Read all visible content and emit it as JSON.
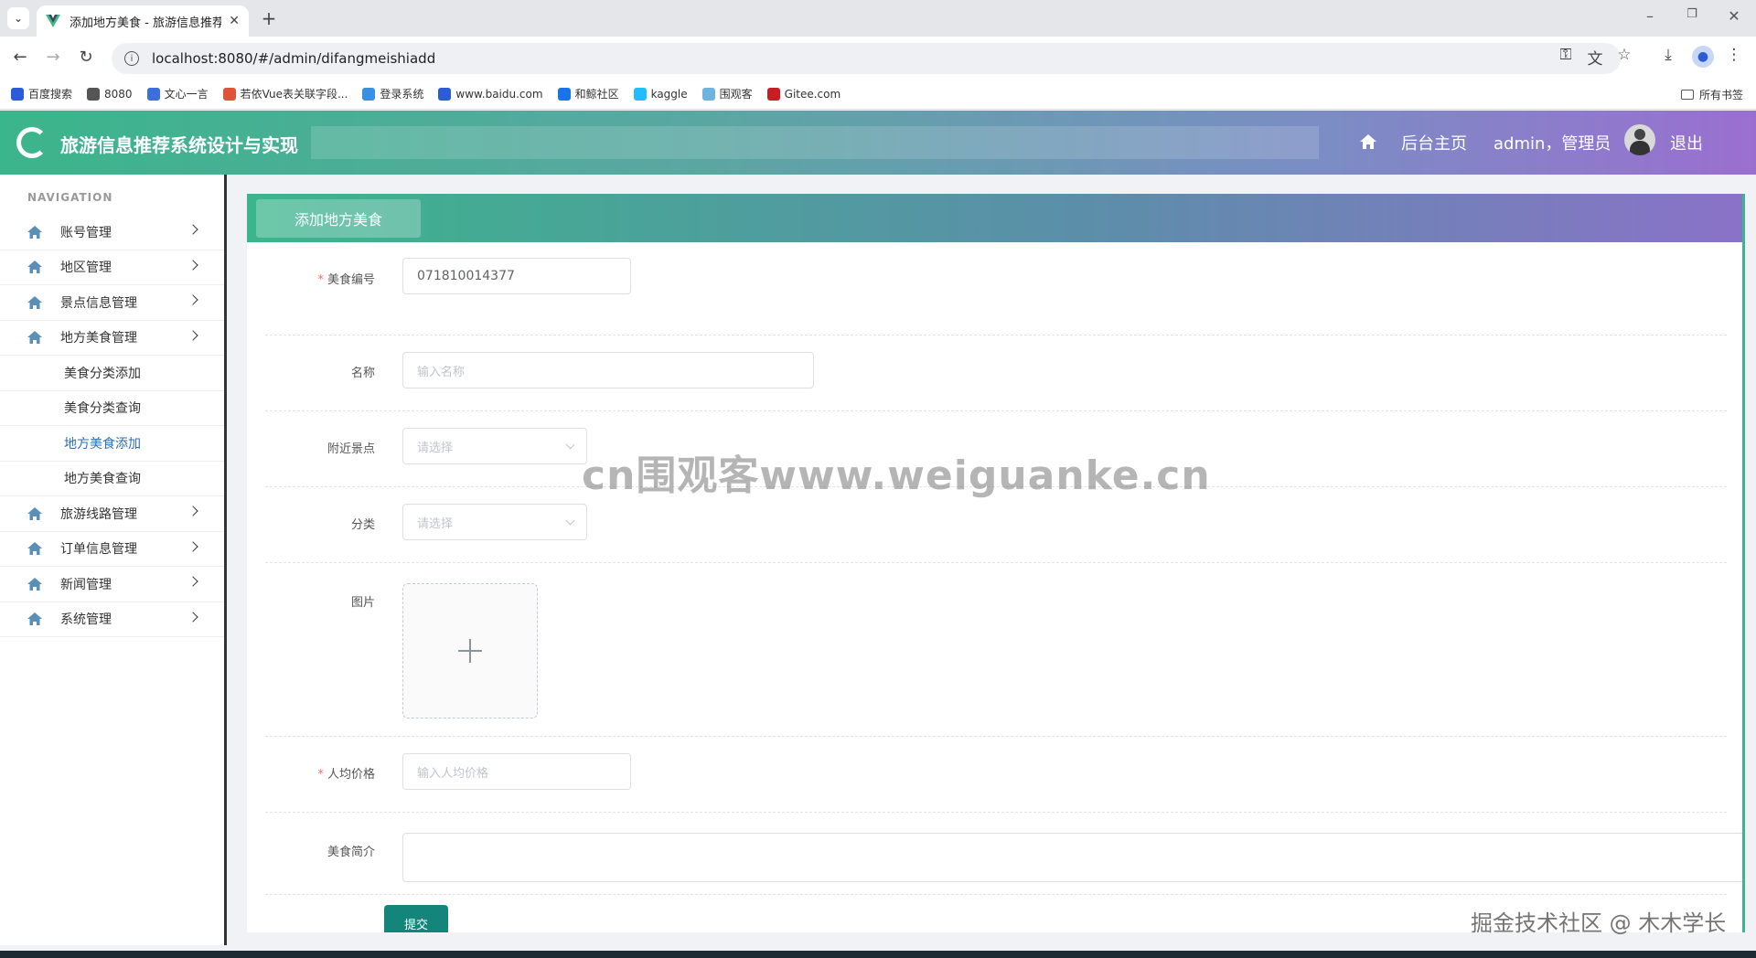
{
  "browser": {
    "tab_title": "添加地方美食 - 旅游信息推荐系",
    "url": "localhost:8080/#/admin/difangmeishiadd",
    "bookmarks": [
      {
        "label": "百度搜索",
        "color": "#2b5bd7"
      },
      {
        "label": "8080",
        "color": "#555555"
      },
      {
        "label": "文心一言",
        "color": "#3b6fe0"
      },
      {
        "label": "若依Vue表关联字段...",
        "color": "#e0533b"
      },
      {
        "label": "登录系统",
        "color": "#3b8fe0"
      },
      {
        "label": "www.baidu.com",
        "color": "#2b5bd7"
      },
      {
        "label": "和鲸社区",
        "color": "#1a73e8"
      },
      {
        "label": "kaggle",
        "color": "#20beff"
      },
      {
        "label": "围观客",
        "color": "#6fb3e0"
      },
      {
        "label": "Gitee.com",
        "color": "#c71d23"
      }
    ],
    "all_bookmarks": "所有书签"
  },
  "header": {
    "title": "旅游信息推荐系统设计与实现",
    "home_link": "后台主页",
    "user": "admin，管理员",
    "logout": "退出"
  },
  "sidebar": {
    "caption": "NAVIGATION",
    "items": [
      {
        "label": "账号管理",
        "expandable": true
      },
      {
        "label": "地区管理",
        "expandable": true
      },
      {
        "label": "景点信息管理",
        "expandable": true
      },
      {
        "label": "地方美食管理",
        "expandable": true
      },
      {
        "label": "美食分类添加",
        "sub": true
      },
      {
        "label": "美食分类查询",
        "sub": true
      },
      {
        "label": "地方美食添加",
        "sub": true,
        "active": true
      },
      {
        "label": "地方美食查询",
        "sub": true
      },
      {
        "label": "旅游线路管理",
        "expandable": true
      },
      {
        "label": "订单信息管理",
        "expandable": true
      },
      {
        "label": "新闻管理",
        "expandable": true
      },
      {
        "label": "系统管理",
        "expandable": true
      }
    ]
  },
  "page": {
    "tab": "添加地方美食",
    "form": {
      "code_label": "美食编号",
      "code_value": "071810014377",
      "name_label": "名称",
      "name_placeholder": "输入名称",
      "spot_label": "附近景点",
      "spot_placeholder": "请选择",
      "category_label": "分类",
      "category_placeholder": "请选择",
      "image_label": "图片",
      "price_label": "人均价格",
      "price_placeholder": "输入人均价格",
      "intro_label": "美食简介",
      "submit": "提交"
    }
  },
  "watermarks": {
    "center": "cn围观客www.weiguanke.cn",
    "corner": "掘金技术社区 @ 木木学长"
  },
  "colors": {
    "accent": "#3bb58b",
    "accent2": "#8a72c8",
    "submit": "#14857b",
    "required": "#f56c6c",
    "active_menu": "#2f6db3"
  }
}
